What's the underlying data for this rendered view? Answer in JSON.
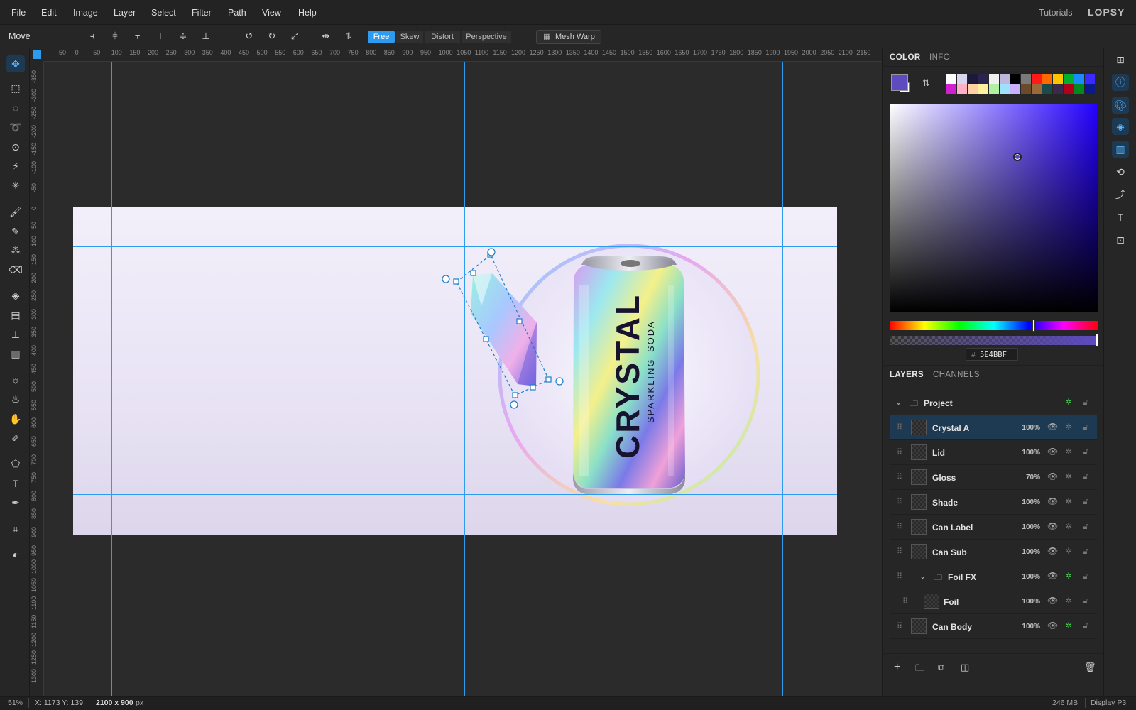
{
  "menu": {
    "items": [
      "File",
      "Edit",
      "Image",
      "Layer",
      "Select",
      "Filter",
      "Path",
      "View",
      "Help"
    ],
    "tutorials": "Tutorials",
    "brand": "LOPSY"
  },
  "options": {
    "tool_name": "Move",
    "transform_modes": [
      "Free",
      "Skew",
      "Distort",
      "Perspective"
    ],
    "active_mode": "Free",
    "mesh_warp": "Mesh Warp"
  },
  "ruler": {
    "top_ticks": [
      "-50",
      "0",
      "50",
      "100",
      "150",
      "200",
      "250",
      "300",
      "350",
      "400",
      "450",
      "500",
      "550",
      "600",
      "650",
      "700",
      "750",
      "800",
      "850",
      "900",
      "950",
      "1000",
      "1050",
      "1100",
      "1150",
      "1200",
      "1250",
      "1300",
      "1350",
      "1400",
      "1450",
      "1500",
      "1550",
      "1600",
      "1650",
      "1700",
      "1750",
      "1800",
      "1850",
      "1900",
      "1950",
      "2000",
      "2050",
      "2100",
      "2150"
    ],
    "left_ticks": [
      "-350",
      "-300",
      "-250",
      "-200",
      "-150",
      "-100",
      "-50",
      "0",
      "50",
      "100",
      "150",
      "200",
      "250",
      "300",
      "350",
      "400",
      "450",
      "500",
      "550",
      "600",
      "650",
      "700",
      "750",
      "800",
      "850",
      "900",
      "950",
      "1000",
      "1050",
      "1100",
      "1150",
      "1200",
      "1250",
      "1300"
    ]
  },
  "artwork": {
    "brand_text": "CRYSTAL",
    "sub_left": "SPARKLING",
    "sub_right": "SODA"
  },
  "color_panel": {
    "tabs": [
      "COLOR",
      "INFO"
    ],
    "active_tab": "COLOR",
    "foreground": "#5E4BBF",
    "hex_prefix": "#",
    "hex_value": "5E4BBF",
    "swatches_row1": [
      "#ffffff",
      "#d9d4f0",
      "#1c1a3a",
      "#2a2450",
      "#f0f0f0",
      "#bdb8dc",
      "#000000",
      "#7a7a7a",
      "#ff1a1a",
      "#ff6a00",
      "#ffc400",
      "#00b030",
      "#1a8cff",
      "#3a2aff"
    ],
    "swatches_row2": [
      "#d020d0",
      "#ffb0c8",
      "#ffd0a0",
      "#fff0a0",
      "#b0f0a0",
      "#a0e0ff",
      "#c8b0ff",
      "#6a4a2a",
      "#9a6a3a",
      "#1a4a4a",
      "#3a2a4a",
      "#b0001a",
      "#008a20",
      "#0a1a8a"
    ],
    "hue_fraction": 0.69,
    "picker_saturation": 0.61,
    "picker_value": 0.75
  },
  "layers_panel": {
    "tabs": [
      "LAYERS",
      "CHANNELS"
    ],
    "active_tab": "LAYERS",
    "group": "Project",
    "layers": [
      {
        "name": "Crystal A",
        "opacity": "100%",
        "selected": true
      },
      {
        "name": "Lid",
        "opacity": "100%"
      },
      {
        "name": "Gloss",
        "opacity": "70%"
      },
      {
        "name": "Shade",
        "opacity": "100%"
      },
      {
        "name": "Can Label",
        "opacity": "100%"
      },
      {
        "name": "Can Sub",
        "opacity": "100%"
      },
      {
        "name": "Foil FX",
        "opacity": "100%",
        "group": true
      },
      {
        "name": "Foil",
        "opacity": "100%",
        "child": true
      },
      {
        "name": "Can Body",
        "opacity": "100%"
      }
    ]
  },
  "status": {
    "zoom": "51%",
    "coords": "X: 1173 Y: 139",
    "doc_size_value": "2100 x 900",
    "doc_size_unit": "px",
    "memory": "246 MB",
    "color_profile": "Display P3"
  },
  "colors": {
    "accent": "#2d9bf0",
    "selection": "#1e3a52",
    "fx_active": "#46c94f"
  }
}
